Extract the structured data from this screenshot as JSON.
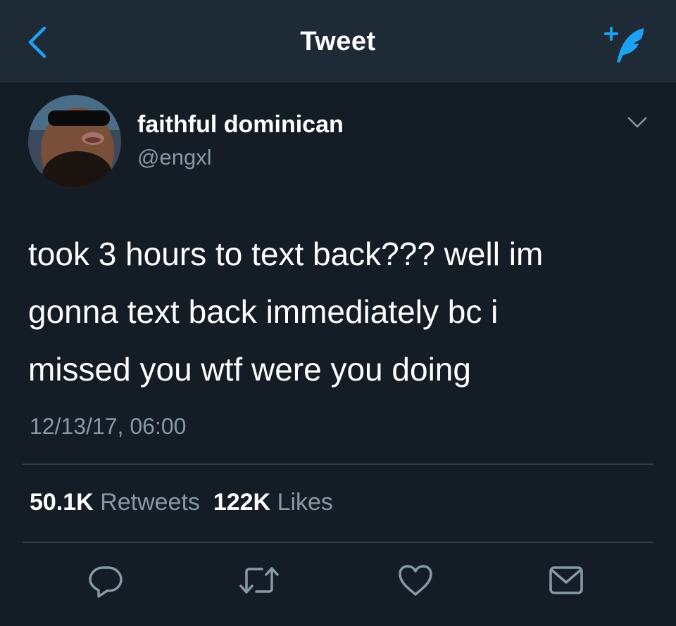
{
  "navbar": {
    "title": "Tweet",
    "back_icon": "chevron-left-icon",
    "compose_icon": "compose-tweet-icon",
    "accent_color": "#1da1f2"
  },
  "tweet": {
    "display_name": "faithful dominican",
    "handle": "@engxl",
    "text_lines": [
      "took 3 hours to text back??? well im",
      "gonna text back immediately bc i",
      "missed you wtf were you doing"
    ],
    "timestamp": "12/13/17, 06:00",
    "retweets_count": "50.1K",
    "retweets_label": "Retweets",
    "likes_count": "122K",
    "likes_label": "Likes"
  },
  "actions": [
    "reply-icon",
    "retweet-icon",
    "like-icon",
    "message-icon"
  ],
  "colors": {
    "background": "#141d26",
    "navbar": "#1f2a37",
    "secondary_text": "#8899a6",
    "divider": "#2f3b48"
  }
}
